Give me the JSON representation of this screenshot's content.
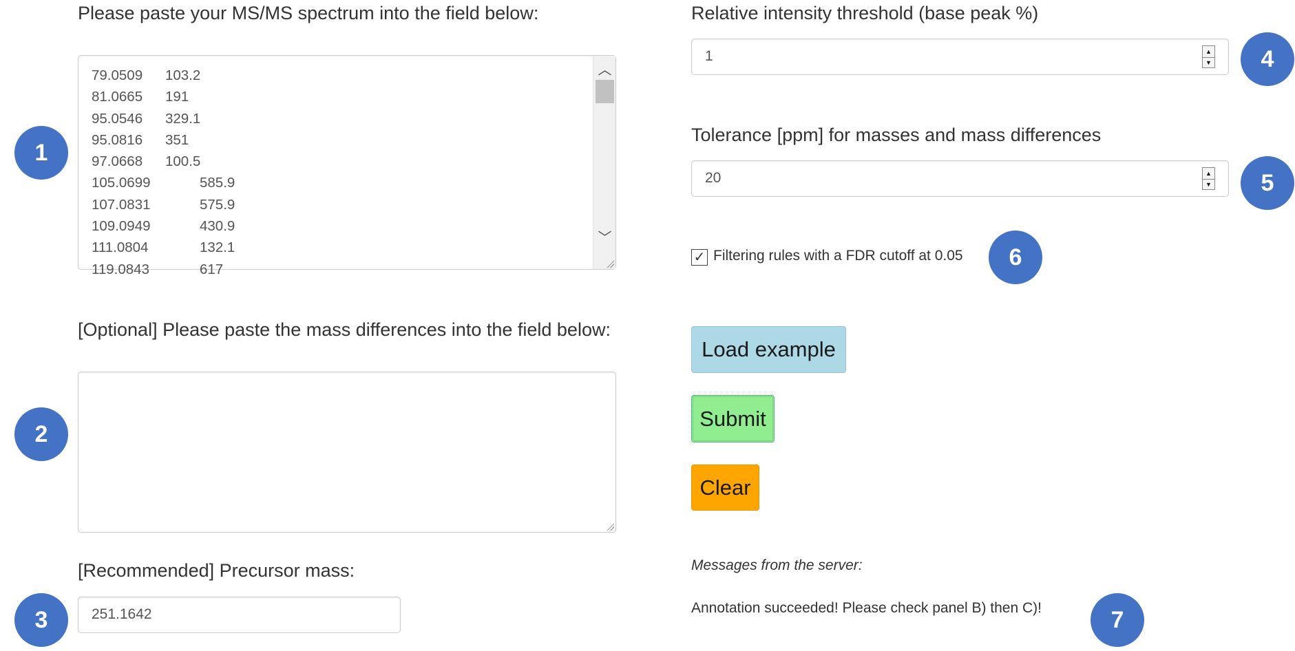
{
  "left": {
    "spectrum_label": "Please paste your MS/MS spectrum into the field below:",
    "spectrum_rows": [
      [
        "79.0509",
        "103.2"
      ],
      [
        "81.0665",
        "191"
      ],
      [
        "95.0546",
        "329.1"
      ],
      [
        "95.0816",
        "351"
      ],
      [
        "97.0668",
        "100.5"
      ],
      [
        "105.0699",
        "585.9"
      ],
      [
        "107.0831",
        "575.9"
      ],
      [
        "109.0949",
        "430.9"
      ],
      [
        "111.0804",
        "132.1"
      ],
      [
        "119.0843",
        "617"
      ]
    ],
    "massdiff_label": "[Optional] Please paste the mass differences into the field below:",
    "massdiff_value": "",
    "precursor_label": "[Recommended] Precursor mass:",
    "precursor_value": "251.1642"
  },
  "right": {
    "threshold_label": "Relative intensity threshold (base peak %)",
    "threshold_value": "1",
    "tolerance_label": "Tolerance [ppm] for masses and mass differences",
    "tolerance_value": "20",
    "fdr_label": "Filtering rules with a FDR cutoff at 0.05",
    "fdr_checked": true,
    "buttons": {
      "load_example": "Load example",
      "submit": "Submit",
      "clear": "Clear"
    },
    "messages_title": "Messages from the server:",
    "messages_body": "Annotation succeeded! Please check panel B) then C)!"
  },
  "badges": [
    "1",
    "2",
    "3",
    "4",
    "5",
    "6",
    "7"
  ],
  "colors": {
    "badge": "#4472c4",
    "load_example_bg": "#add8e6",
    "submit_bg": "#90ee90",
    "clear_bg": "#ffa500"
  },
  "icons": {
    "checkbox": "check-mark-icon",
    "spinner_up": "triangle-up-icon",
    "spinner_down": "triangle-down-icon",
    "scroll_up": "chevron-up-icon",
    "scroll_down": "chevron-down-icon"
  }
}
